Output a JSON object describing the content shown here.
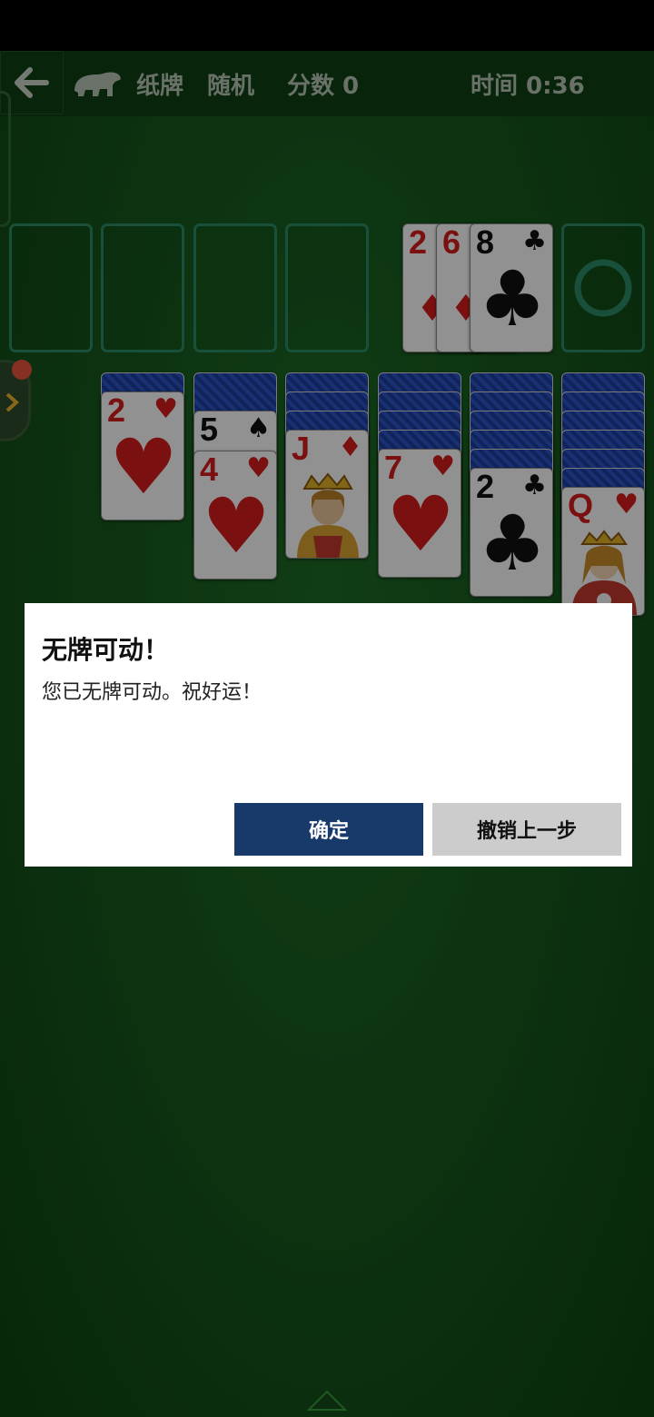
{
  "header": {
    "game_name": "纸牌",
    "mode": "随机",
    "score_label": "分数 0",
    "time_label": "时间 0:36"
  },
  "stock_waste": {
    "waste_cards": [
      {
        "rank": "2",
        "suit": "♦",
        "color": "red"
      },
      {
        "rank": "6",
        "suit": "♦",
        "color": "red"
      },
      {
        "rank": "8",
        "suit": "♣",
        "color": "black"
      }
    ],
    "stock_empty_icon": "recycle-circle-icon"
  },
  "tableau": [
    {
      "hidden": 1,
      "top": {
        "rank": "2",
        "suit": "♥",
        "color": "red",
        "big": "♥"
      }
    },
    {
      "hidden": 1,
      "face_up": [
        {
          "rank": "5",
          "suit": "♠",
          "color": "black"
        },
        {
          "rank": "4",
          "suit": "♥",
          "color": "red",
          "big": "♥"
        }
      ]
    },
    {
      "hidden": 3,
      "top": {
        "rank": "J",
        "suit": "♦",
        "color": "red",
        "face": "jack"
      }
    },
    {
      "hidden": 4,
      "top": {
        "rank": "7",
        "suit": "♥",
        "color": "red",
        "big": "♥"
      }
    },
    {
      "hidden": 5,
      "top": {
        "rank": "2",
        "suit": "♣",
        "color": "black",
        "big": "♣"
      }
    },
    {
      "hidden": 6,
      "top": {
        "rank": "Q",
        "suit": "♥",
        "color": "red",
        "face": "queen"
      }
    }
  ],
  "dialog": {
    "title": "无牌可动！",
    "message": "您已无牌可动。祝好运！",
    "ok_label": "确定",
    "undo_label": "撤销上一步"
  },
  "colors": {
    "felt": "#15561c",
    "ok_button": "#173a6a",
    "undo_button": "#cccccc",
    "foundation_outline": "#2c8a66"
  }
}
